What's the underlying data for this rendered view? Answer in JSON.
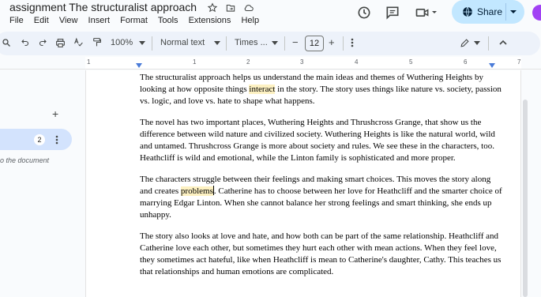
{
  "titlebar": {
    "doc_title": "assignment The structuralist approach",
    "menu": [
      "File",
      "Edit",
      "View",
      "Insert",
      "Format",
      "Tools",
      "Extensions",
      "Help"
    ],
    "share_label": "Share"
  },
  "toolbar": {
    "zoom": "100%",
    "style": "Normal text",
    "font": "Times ...",
    "font_size": "12",
    "minus": "−",
    "plus": "+"
  },
  "ruler": {
    "numbers": [
      "1",
      "1",
      "2",
      "3",
      "4",
      "5",
      "6",
      "7"
    ]
  },
  "outline": {
    "add": "+",
    "count": "2",
    "hint": "o the document"
  },
  "document": {
    "p1_a": "The structuralist approach helps us understand the main ideas and themes of Wuthering Heights by looking at how opposite things ",
    "p1_hl": "interact",
    "p1_b": " in the story. The story uses things like nature vs. society, passion vs. logic, and love vs. hate to shape what happens.",
    "p2": "The novel has two important places, Wuthering Heights and Thrushcross Grange, that show us the difference between wild nature and civilized society. Wuthering Heights is like the natural world, wild and untamed. Thrushcross Grange is more about society and rules. We see these in the characters, too. Heathcliff is wild and emotional, while the Linton family is sophisticated and more proper.",
    "p3_a": "The characters struggle between their feelings and making smart choices. This moves the story along and creates ",
    "p3_hl": "problems",
    "p3_b": ". Catherine has to choose between her love for Heathcliff and the smarter choice of marrying Edgar Linton. When she cannot balance her strong feelings and smart thinking, she ends up unhappy.",
    "p4": "The story also looks at love and hate, and how both can be part of the same relationship. Heathcliff and Catherine love each other, but sometimes they hurt each other with mean actions. When they feel love, they sometimes act hateful, like when Heathcliff is mean to Catherine's daughter, Cathy. This teaches us that relationships and human emotions are complicated."
  }
}
